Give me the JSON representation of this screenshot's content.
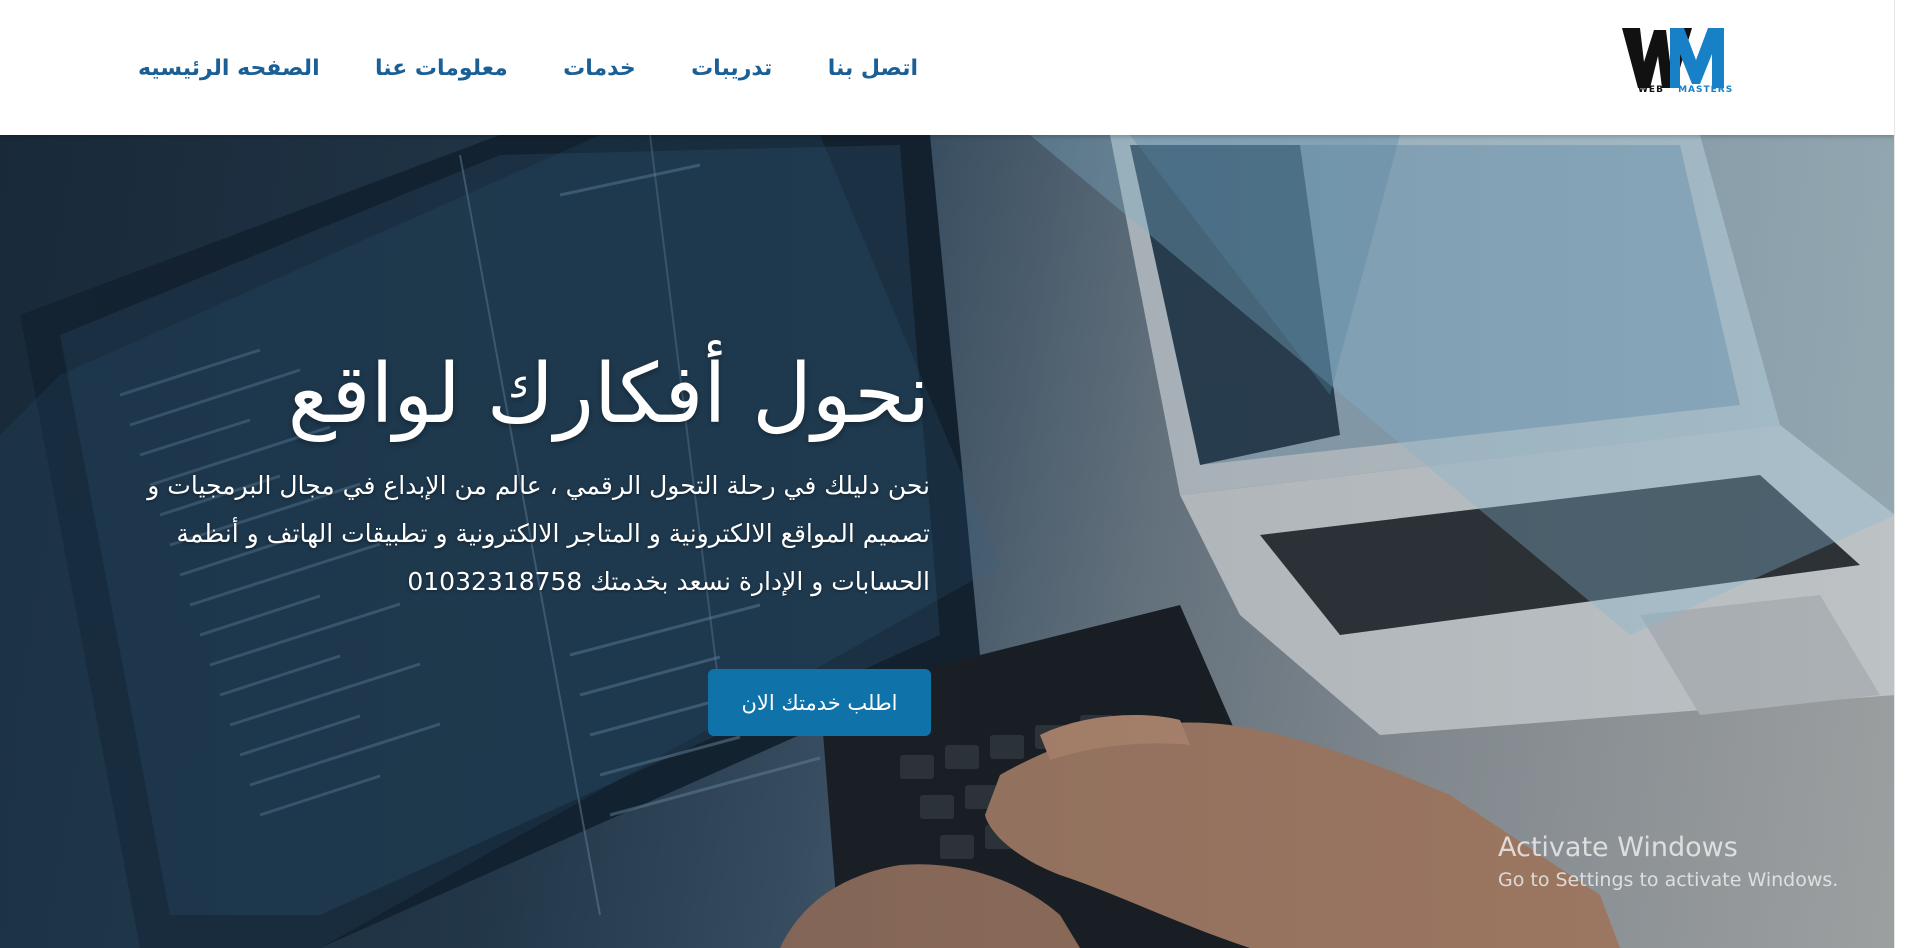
{
  "header": {
    "logo": {
      "mark": "WM",
      "sub_word_1": "WEB",
      "sub_word_2": "MASTERS"
    },
    "nav": [
      {
        "label": "الصفحه الرئيسيه"
      },
      {
        "label": "معلومات عنا"
      },
      {
        "label": "خدمات"
      },
      {
        "label": "تدريبات"
      },
      {
        "label": "اتصل بنا"
      }
    ]
  },
  "hero": {
    "title": "نحول أفكارك لواقع",
    "description": "نحن دليلك في رحلة التحول الرقمي ، عالم من الإبداع في مجال البرمجيات و تصميم المواقع الالكترونية و المتاجر الالكترونية و تطبيقات الهاتف و أنظمة الحسابات و الإدارة نسعد بخدمتك 01032318758",
    "cta_label": "اطلب خدمتك الان"
  },
  "watermark": {
    "title": "Activate Windows",
    "subtitle": "Go to Settings to activate Windows."
  },
  "colors": {
    "nav_text": "#1a5f96",
    "cta_bg": "#0f72a9",
    "logo_blue": "#1780c6",
    "logo_black": "#111111"
  }
}
